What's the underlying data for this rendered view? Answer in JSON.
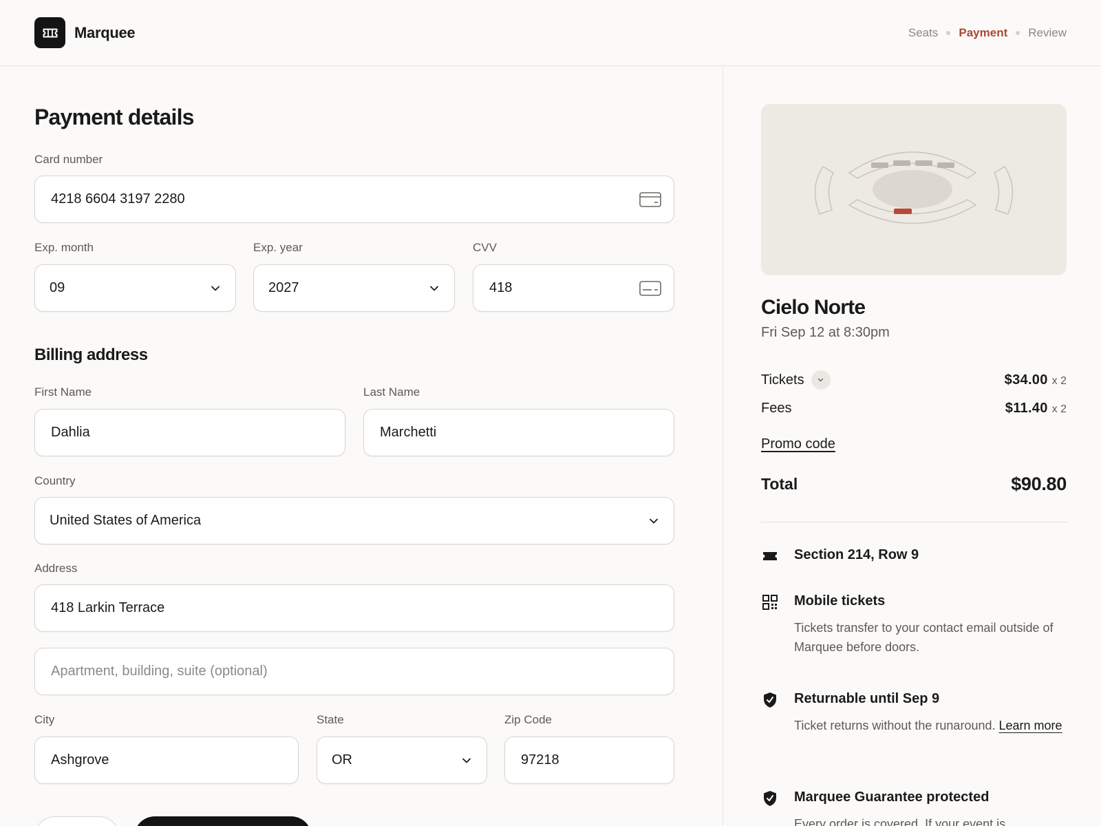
{
  "header": {
    "brand": "Marquee",
    "steps": [
      "Seats",
      "Payment",
      "Review"
    ],
    "active_step": "Payment"
  },
  "form": {
    "title": "Payment details",
    "card": {
      "label": "Card number",
      "value": "4218 6604 3197 2280"
    },
    "exp_month": {
      "label": "Exp. month",
      "value": "09"
    },
    "exp_year": {
      "label": "Exp. year",
      "value": "2027"
    },
    "cvv": {
      "label": "CVV",
      "value": "418"
    },
    "billing_title": "Billing address",
    "first_name": {
      "label": "First Name",
      "value": "Dahlia"
    },
    "last_name": {
      "label": "Last Name",
      "value": "Marchetti"
    },
    "country": {
      "label": "Country",
      "value": "United States of America"
    },
    "address": {
      "label": "Address",
      "value": "418 Larkin Terrace"
    },
    "address2": {
      "placeholder": "Apartment, building, suite (optional)"
    },
    "city": {
      "label": "City",
      "value": "Ashgrove"
    },
    "state": {
      "label": "State",
      "value": "OR"
    },
    "zip": {
      "label": "Zip Code",
      "value": "97218"
    }
  },
  "summary": {
    "event_title": "Cielo Norte",
    "event_date": "Fri Sep 12 at 8:30pm",
    "tickets": {
      "label": "Tickets",
      "amount": "$34.00",
      "qty": "x 2"
    },
    "fees": {
      "label": "Fees",
      "amount": "$11.40",
      "qty": "x 2"
    },
    "promo": "Promo code",
    "total_label": "Total",
    "total_value": "$90.80",
    "features": [
      {
        "icon": "ticket-icon",
        "title": "Section 214, Row 9"
      },
      {
        "icon": "qr-code-icon",
        "title": "Mobile tickets",
        "desc": "Tickets transfer to your contact email outside of Marquee before doors."
      },
      {
        "icon": "shield-check-icon",
        "title": "Returnable until Sep 9",
        "desc": "Ticket returns without the runaround.",
        "link": "Learn more"
      },
      {
        "icon": "shield-check-icon",
        "title": "Marquee Guarantee protected",
        "desc": "Every order is covered. If your event is"
      }
    ]
  },
  "colors": {
    "accent": "#a84a32",
    "seat_highlight": "#b8473a",
    "background": "#fbfaf8",
    "dark": "#141414"
  }
}
